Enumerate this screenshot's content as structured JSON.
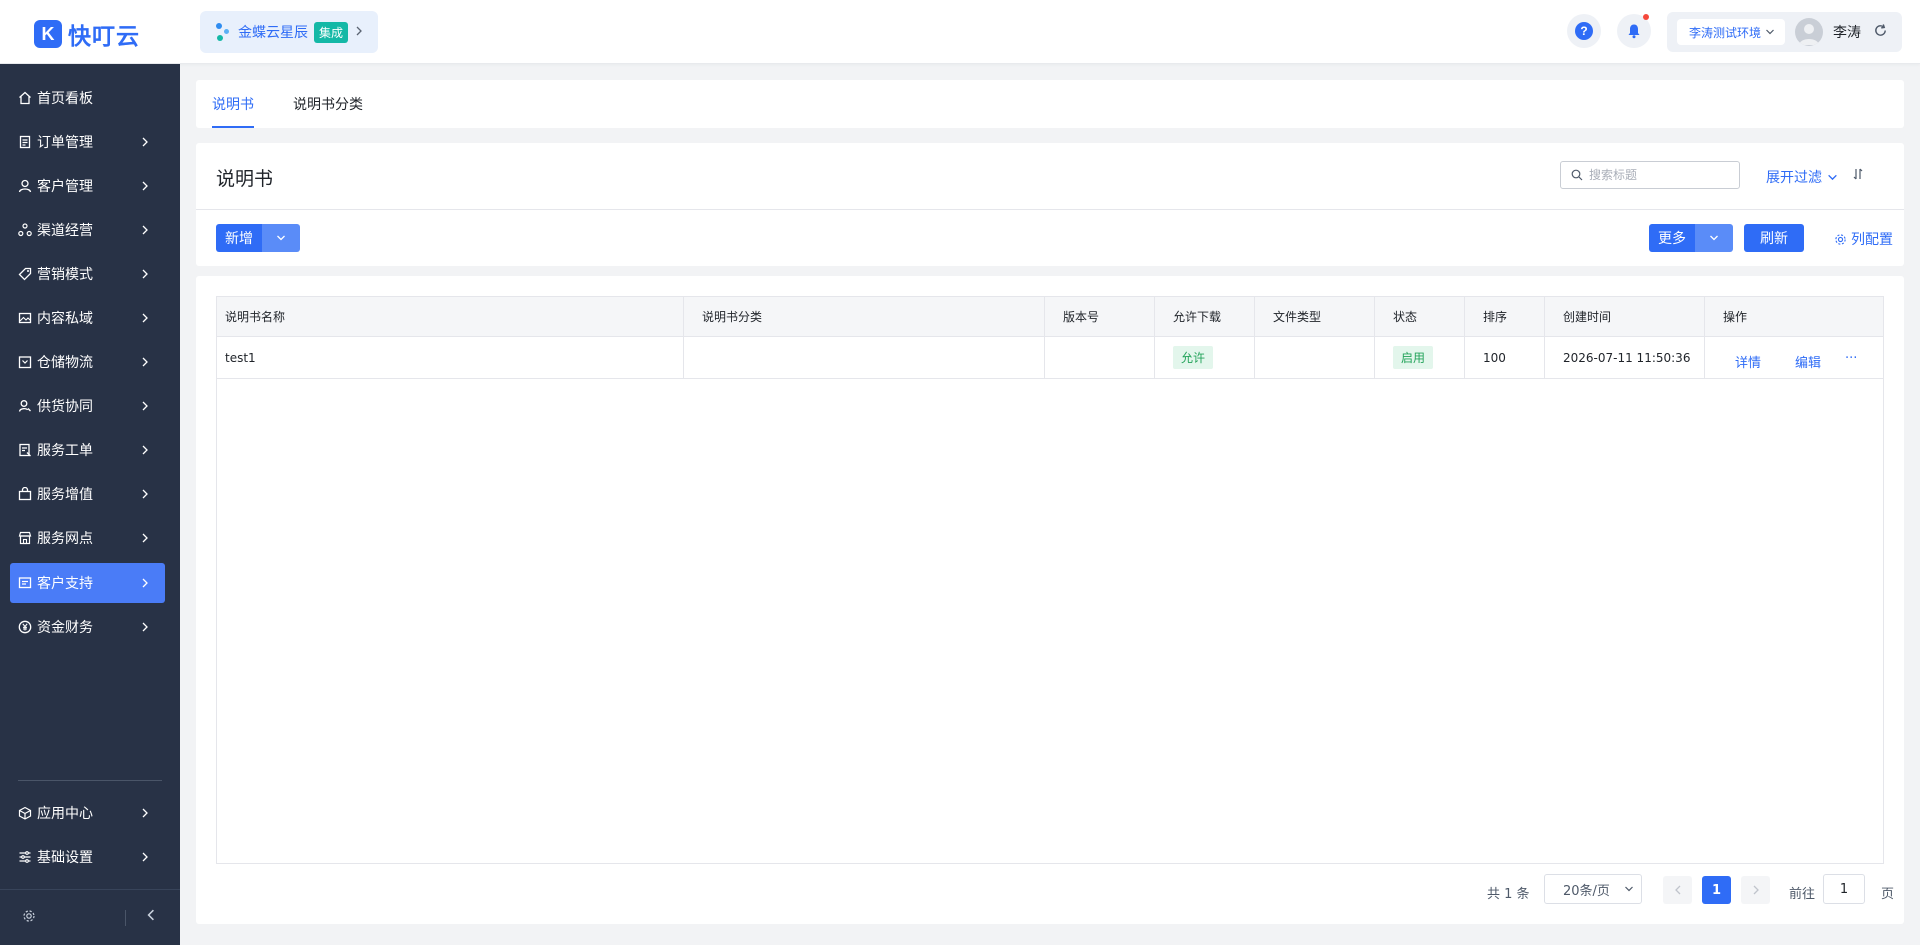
{
  "header": {
    "logo_text": "快叮云",
    "logo_mark": "K",
    "brand_name": "金蝶云星辰",
    "brand_tag": "集成",
    "help_glyph": "?",
    "env_label": "李涛测试环境",
    "user_name": "李涛"
  },
  "sidebar": {
    "items": [
      {
        "label": "首页看板",
        "icon": "home-icon",
        "has_arrow": false
      },
      {
        "label": "订单管理",
        "icon": "order-doc-icon",
        "has_arrow": true
      },
      {
        "label": "客户管理",
        "icon": "user-icon",
        "has_arrow": true
      },
      {
        "label": "渠道经营",
        "icon": "channel-icon",
        "has_arrow": true
      },
      {
        "label": "营销模式",
        "icon": "tag-icon",
        "has_arrow": true
      },
      {
        "label": "内容私域",
        "icon": "image-icon",
        "has_arrow": true
      },
      {
        "label": "仓储物流",
        "icon": "warehouse-icon",
        "has_arrow": true
      },
      {
        "label": "供货协同",
        "icon": "supply-user-icon",
        "has_arrow": true
      },
      {
        "label": "服务工单",
        "icon": "work-order-icon",
        "has_arrow": true
      },
      {
        "label": "服务增值",
        "icon": "bag-icon",
        "has_arrow": true
      },
      {
        "label": "服务网点",
        "icon": "store-icon",
        "has_arrow": true
      },
      {
        "label": "客户支持",
        "icon": "support-icon",
        "has_arrow": true,
        "active": true
      },
      {
        "label": "资金财务",
        "icon": "yuan-icon",
        "has_arrow": true
      }
    ],
    "bottom_items": [
      {
        "label": "应用中心",
        "icon": "cube-icon"
      },
      {
        "label": "基础设置",
        "icon": "settings-list-icon"
      }
    ]
  },
  "tabs": [
    {
      "label": "说明书",
      "active": true
    },
    {
      "label": "说明书分类",
      "active": false
    }
  ],
  "page": {
    "title": "说明书",
    "search_placeholder": "搜索标题",
    "expand_filter": "展开过滤",
    "add_button": "新增",
    "more_button": "更多",
    "refresh_button": "刷新",
    "column_config": "列配置"
  },
  "table": {
    "columns": [
      "说明书名称",
      "说明书分类",
      "版本号",
      "允许下载",
      "文件类型",
      "状态",
      "排序",
      "创建时间",
      "操作"
    ],
    "rows": [
      {
        "name": "test1",
        "category": "",
        "version": "",
        "allow_download": "允许",
        "file_type": "",
        "status": "启用",
        "sort": "100",
        "created_at": "2026-07-11 11:50:36",
        "actions": {
          "detail": "详情",
          "edit": "编辑",
          "more": "..."
        }
      }
    ]
  },
  "pagination": {
    "total_text": "共 1 条",
    "page_size": "20条/页",
    "current_page": "1",
    "goto_label": "前往",
    "goto_value": "1",
    "page_unit": "页"
  },
  "colors": {
    "primary": "#2f6cf6",
    "sidebar_bg": "#283246",
    "sidebar_active": "#4a7cf7",
    "success": "#23a35a"
  }
}
